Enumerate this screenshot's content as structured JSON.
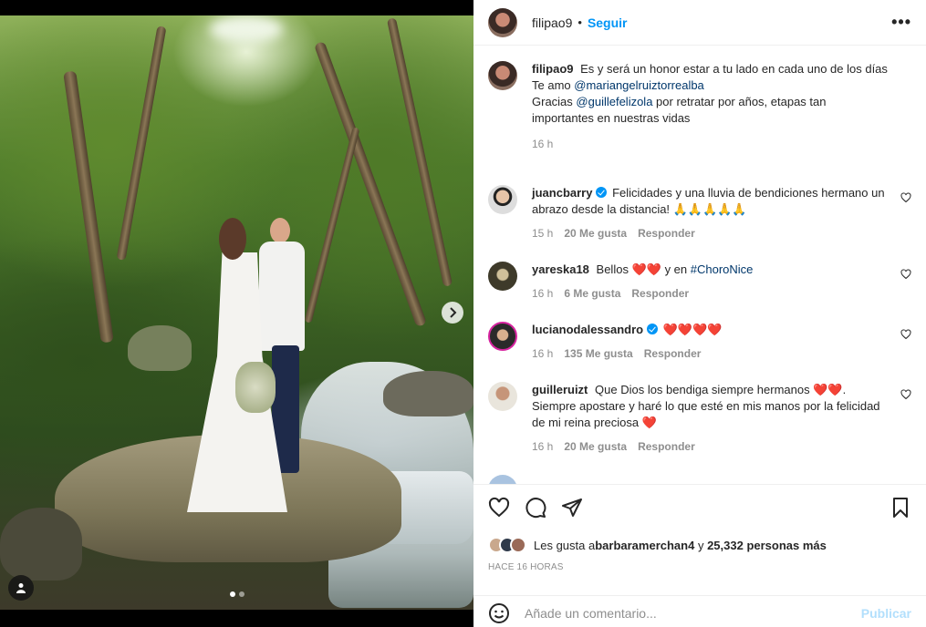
{
  "post": {
    "author": "filipao9",
    "follow_label": "Seguir",
    "separator": "•",
    "more_label": "•••",
    "carousel_total_dots": 2
  },
  "caption": {
    "username": "filipao9",
    "line1": "Es y será un honor estar a tu lado en cada uno de los días",
    "line2_prefix": "Te amo ",
    "line2_mention": "@mariangelruiztorrealba",
    "line3_prefix": "Gracias ",
    "line3_mention": "@guillefelizola",
    "line3_suffix": " por retratar por años, etapas tan importantes en nuestras vidas",
    "time": "16 h"
  },
  "comments": [
    {
      "username": "juancbarry",
      "verified": true,
      "text": "Felicidades y una lluvia de bendiciones hermano un abrazo desde la distancia! 🙏🙏🙏🙏🙏",
      "time": "15 h",
      "likes": "20 Me gusta",
      "reply": "Responder"
    },
    {
      "username": "yareska18",
      "text_prefix": "Bellos ",
      "hearts": "❤️❤️",
      "text_mid": "y en ",
      "hashtag": "#ChoroNice",
      "time": "16 h",
      "likes": "6 Me gusta",
      "reply": "Responder"
    },
    {
      "username": "lucianodalessandro",
      "verified": true,
      "text": "❤️❤️❤️❤️",
      "time": "16 h",
      "likes": "135 Me gusta",
      "reply": "Responder"
    },
    {
      "username": "guilleruizt",
      "text": "Que Dios los bendiga siempre hermanos ❤️❤️. Siempre apostare y haré lo que esté en mis manos por la felicidad de mi reina preciosa ❤️",
      "time": "16 h",
      "likes": "20 Me gusta",
      "reply": "Responder"
    }
  ],
  "likes": {
    "prefix": "Les gusta a ",
    "first_user": "barbaramerchan4",
    "middle": " y ",
    "others": "25,332 personas más"
  },
  "time_ago": "Hace 16 horas",
  "add_comment": {
    "placeholder": "Añade un comentario...",
    "publish_label": "Publicar"
  },
  "icons": {
    "like": "heart-icon",
    "comment": "comment-icon",
    "share": "paper-plane-icon",
    "save": "bookmark-icon",
    "emoji": "smiley-icon",
    "next": "chevron-right-icon",
    "tagged": "user-icon"
  },
  "colors": {
    "accent": "#0095f6",
    "heart": "#e0245e",
    "mention": "#00376b",
    "muted": "#8e8e8e"
  }
}
